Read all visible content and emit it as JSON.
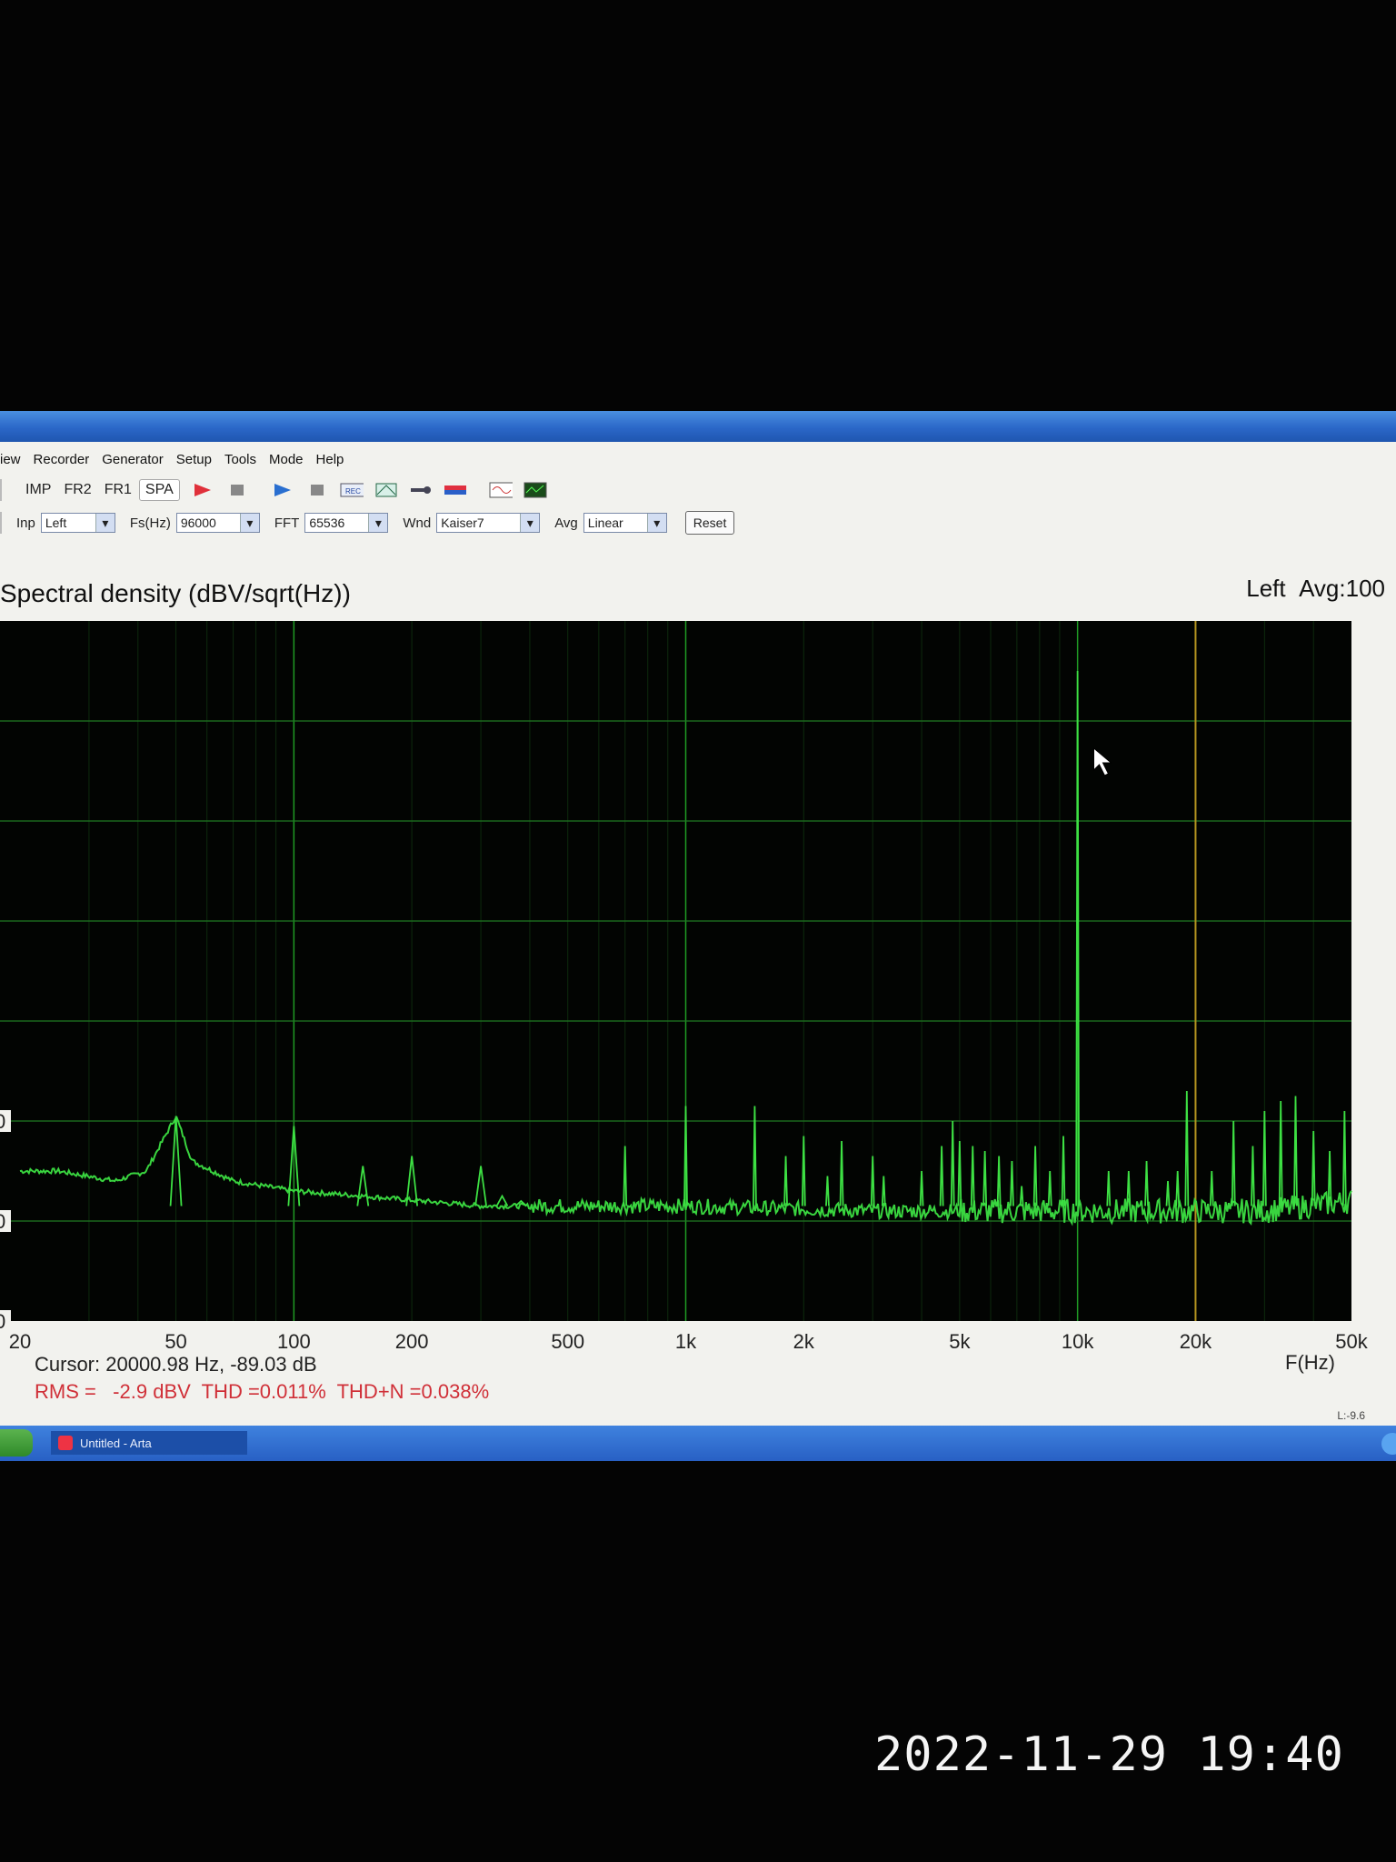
{
  "menu": [
    "iew",
    "Recorder",
    "Generator",
    "Setup",
    "Tools",
    "Mode",
    "Help"
  ],
  "toolbar": {
    "modes": [
      "IMP",
      "FR2",
      "FR1",
      "SPA"
    ],
    "active_mode": "SPA",
    "icons": [
      "record-red-icon",
      "stop-icon",
      "play-blue-icon",
      "stop-icon",
      "rec-icon",
      "graph-icon",
      "key-icon",
      "flag-icon",
      "wave-icon",
      "scope-icon"
    ]
  },
  "controls": {
    "inp_label": "Inp",
    "inp_value": "Left",
    "fs_label": "Fs(Hz)",
    "fs_value": "96000",
    "fft_label": "FFT",
    "fft_value": "65536",
    "wnd_label": "Wnd",
    "wnd_value": "Kaiser7",
    "avg_label": "Avg",
    "avg_value": "Linear",
    "reset_label": "Reset"
  },
  "plot": {
    "title": "Spectral density (dBV/sqrt(Hz))",
    "channel": "Left",
    "avg": "Avg:100",
    "xlabel": "F(Hz)",
    "cursor": "Cursor: 20000.98 Hz, -89.03 dB",
    "stats": "RMS =   -2.9 dBV  THD =0.011%  THD+N =0.038%",
    "status_right": "L:-9.6"
  },
  "chart_data": {
    "type": "line",
    "title": "Spectral density (dBV/sqrt(Hz))",
    "xlabel": "F(Hz)",
    "x_scale": "log",
    "x_ticks": [
      20,
      50,
      100,
      200,
      500,
      1000,
      2000,
      5000,
      10000,
      20000,
      50000
    ],
    "x_tick_labels": [
      "20",
      "50",
      "100",
      "200",
      "500",
      "1k",
      "2k",
      "5k",
      "10k",
      "20k",
      "50k"
    ],
    "xlim": [
      20,
      50000
    ],
    "ylim": [
      -180,
      -40
    ],
    "y_tick_labels_partial": [
      "0",
      "0",
      "0"
    ],
    "grid": true,
    "cursor_x": 20000.98,
    "noise_floor": [
      [
        20,
        -150
      ],
      [
        25,
        -150
      ],
      [
        35,
        -152
      ],
      [
        42,
        -150
      ],
      [
        50,
        -139
      ],
      [
        55,
        -148
      ],
      [
        70,
        -152
      ],
      [
        100,
        -154
      ],
      [
        150,
        -155
      ],
      [
        300,
        -157
      ],
      [
        1000,
        -157
      ],
      [
        3000,
        -158
      ],
      [
        10000,
        -158
      ],
      [
        30000,
        -158
      ],
      [
        50000,
        -156
      ]
    ],
    "peaks": [
      [
        50,
        -139
      ],
      [
        100,
        -141
      ],
      [
        150,
        -149
      ],
      [
        200,
        -147
      ],
      [
        300,
        -149
      ],
      [
        340,
        -155
      ],
      [
        380,
        -156
      ],
      [
        700,
        -145
      ],
      [
        1000,
        -137
      ],
      [
        1500,
        -137
      ],
      [
        1800,
        -147
      ],
      [
        2000,
        -143
      ],
      [
        2300,
        -151
      ],
      [
        2500,
        -144
      ],
      [
        3000,
        -147
      ],
      [
        3200,
        -151
      ],
      [
        4000,
        -150
      ],
      [
        4500,
        -145
      ],
      [
        4800,
        -140
      ],
      [
        5000,
        -144
      ],
      [
        5400,
        -145
      ],
      [
        5800,
        -146
      ],
      [
        6300,
        -147
      ],
      [
        6800,
        -148
      ],
      [
        7200,
        -153
      ],
      [
        7800,
        -145
      ],
      [
        8500,
        -150
      ],
      [
        9200,
        -143
      ],
      [
        10000,
        -50
      ],
      [
        12000,
        -150
      ],
      [
        13500,
        -150
      ],
      [
        15000,
        -148
      ],
      [
        17000,
        -152
      ],
      [
        18000,
        -150
      ],
      [
        19000,
        -134
      ],
      [
        22000,
        -150
      ],
      [
        25000,
        -140
      ],
      [
        28000,
        -145
      ],
      [
        30000,
        -138
      ],
      [
        33000,
        -136
      ],
      [
        36000,
        -135
      ],
      [
        40000,
        -142
      ],
      [
        44000,
        -146
      ],
      [
        48000,
        -138
      ]
    ]
  },
  "taskbar": {
    "app": "Untitled - Arta"
  },
  "timestamp": "2022-11-29 19:40"
}
